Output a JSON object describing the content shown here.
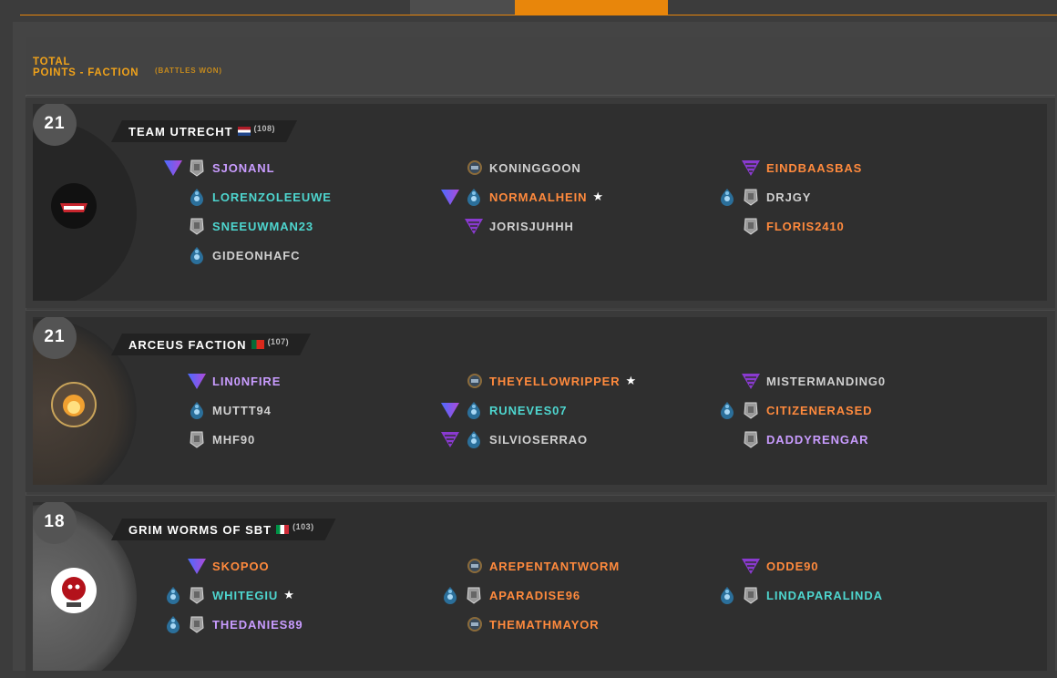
{
  "header": {
    "title_line1": "TOTAL",
    "title_line2": "POINTS - FACTION",
    "subtitle": "(BATTLES WON)"
  },
  "icon_legend": {
    "triangle": "blue-purple-triangle-icon",
    "shield": "silver-shield-icon",
    "droplet": "blue-droplet-icon",
    "helmet": "helmet-icon",
    "chevrons": "purple-chevrons-icon"
  },
  "colors": {
    "accent": "#e8860b",
    "orange_name": "#ff8a3d",
    "teal_name": "#4ed6cf",
    "purple_name": "#c99cff",
    "gray_name": "#d0d0d0"
  },
  "teams": [
    {
      "rank": "21",
      "name": "TEAM UTRECHT",
      "flag": "nl",
      "count": "(108)",
      "players": [
        {
          "name": "SJONANL",
          "color": "purple",
          "icons": [
            "triangle",
            "shield"
          ],
          "star": false,
          "col": 0,
          "row": 0
        },
        {
          "name": "LORENZOLEEUWE",
          "color": "teal",
          "icons": [
            "droplet"
          ],
          "star": false,
          "col": 0,
          "row": 1
        },
        {
          "name": "SNEEUWMAN23",
          "color": "teal",
          "icons": [
            "shield"
          ],
          "star": false,
          "col": 0,
          "row": 2
        },
        {
          "name": "GIDEONHAFC",
          "color": "gray",
          "icons": [
            "droplet"
          ],
          "star": false,
          "col": 0,
          "row": 3
        },
        {
          "name": "KONINGGOON",
          "color": "gray",
          "icons": [
            "helmet"
          ],
          "star": false,
          "col": 1,
          "row": 0
        },
        {
          "name": "NORMAALHEIN",
          "color": "orange",
          "icons": [
            "triangle",
            "droplet"
          ],
          "star": true,
          "col": 1,
          "row": 1
        },
        {
          "name": "JORISJUHHH",
          "color": "gray",
          "icons": [
            "chevrons"
          ],
          "star": false,
          "col": 1,
          "row": 2
        },
        {
          "name": "EINDBAASBAS",
          "color": "orange",
          "icons": [
            "chevrons"
          ],
          "star": false,
          "col": 2,
          "row": 0
        },
        {
          "name": "DRJGY",
          "color": "gray",
          "icons": [
            "droplet",
            "shield"
          ],
          "star": false,
          "col": 2,
          "row": 1
        },
        {
          "name": "FLORIS2410",
          "color": "orange",
          "icons": [
            "shield"
          ],
          "star": false,
          "col": 2,
          "row": 2
        }
      ]
    },
    {
      "rank": "21",
      "name": "ARCEUS FACTION",
      "flag": "pt",
      "count": "(107)",
      "players": [
        {
          "name": "LIN0NFIRE",
          "color": "purple",
          "icons": [
            "triangle"
          ],
          "star": false,
          "col": 0,
          "row": 0
        },
        {
          "name": "MUTTT94",
          "color": "gray",
          "icons": [
            "droplet"
          ],
          "star": false,
          "col": 0,
          "row": 1
        },
        {
          "name": "MHF90",
          "color": "gray",
          "icons": [
            "shield"
          ],
          "star": false,
          "col": 0,
          "row": 2
        },
        {
          "name": "THEYELLOWRIPPER",
          "color": "orange",
          "icons": [
            "helmet"
          ],
          "star": true,
          "col": 1,
          "row": 0
        },
        {
          "name": "RUNEVES07",
          "color": "teal",
          "icons": [
            "triangle",
            "droplet"
          ],
          "star": false,
          "col": 1,
          "row": 1
        },
        {
          "name": "SILVIOSERRAO",
          "color": "gray",
          "icons": [
            "chevrons",
            "droplet"
          ],
          "star": false,
          "col": 1,
          "row": 2
        },
        {
          "name": "MISTERMANDING0",
          "color": "gray",
          "icons": [
            "chevrons"
          ],
          "star": false,
          "col": 2,
          "row": 0
        },
        {
          "name": "CITIZENERASED",
          "color": "orange",
          "icons": [
            "droplet",
            "shield"
          ],
          "star": false,
          "col": 2,
          "row": 1
        },
        {
          "name": "DADDYRENGAR",
          "color": "purple",
          "icons": [
            "shield"
          ],
          "star": false,
          "col": 2,
          "row": 2
        }
      ]
    },
    {
      "rank": "18",
      "name": "GRIM WORMS OF SBT",
      "flag": "it",
      "count": "(103)",
      "players": [
        {
          "name": "SKOPOO",
          "color": "orange",
          "icons": [
            "triangle"
          ],
          "star": false,
          "col": 0,
          "row": 0
        },
        {
          "name": "WHITEGIU",
          "color": "teal",
          "icons": [
            "droplet",
            "shield"
          ],
          "star": true,
          "col": 0,
          "row": 1
        },
        {
          "name": "THEDANIES89",
          "color": "purple",
          "icons": [
            "droplet",
            "shield"
          ],
          "star": false,
          "col": 0,
          "row": 2
        },
        {
          "name": "AREPENTANTWORM",
          "color": "orange",
          "icons": [
            "helmet"
          ],
          "star": false,
          "col": 1,
          "row": 0
        },
        {
          "name": "APARADISE96",
          "color": "orange",
          "icons": [
            "droplet",
            "shield"
          ],
          "star": false,
          "col": 1,
          "row": 1
        },
        {
          "name": "THEMATHMAYOR",
          "color": "orange",
          "icons": [
            "helmet"
          ],
          "star": false,
          "col": 1,
          "row": 2
        },
        {
          "name": "ODDE90",
          "color": "orange",
          "icons": [
            "chevrons"
          ],
          "star": false,
          "col": 2,
          "row": 0
        },
        {
          "name": "LINDAPARALINDA",
          "color": "teal",
          "icons": [
            "droplet",
            "shield"
          ],
          "star": false,
          "col": 2,
          "row": 1
        }
      ]
    }
  ]
}
